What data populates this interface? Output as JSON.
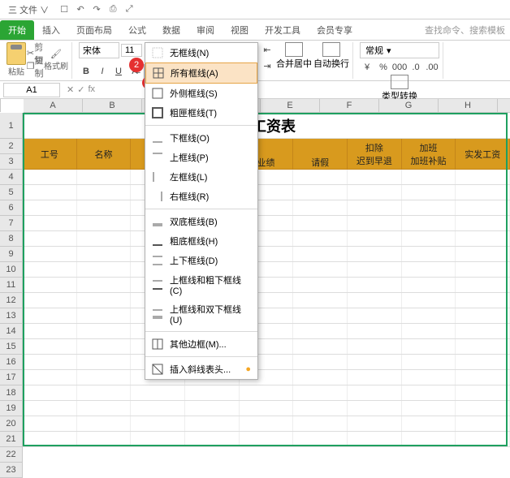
{
  "menubar": {
    "file": "三 文件 ∨",
    "tabs": [
      "开始",
      "插入",
      "页面布局",
      "公式",
      "数据",
      "审阅",
      "视图",
      "开发工具",
      "会员专享"
    ],
    "search_placeholder": "查找命令、搜索模板",
    "active_tab": 0
  },
  "ribbon": {
    "paste": {
      "label": "粘贴",
      "cut": "剪切",
      "copy": "复制",
      "format_painter": "格式刷"
    },
    "font": {
      "name": "宋体",
      "size": "11"
    },
    "buttons": {
      "bold": "B",
      "italic": "I",
      "underline": "U",
      "strike": "A"
    },
    "merge": "合并居中",
    "wrap": "自动换行",
    "number": {
      "format": "常规",
      "convert": "类型转换"
    }
  },
  "namebox": {
    "cell": "A1",
    "fx": "fx"
  },
  "cols": [
    "A",
    "B",
    "C",
    "D",
    "E",
    "F",
    "G",
    "H",
    "I"
  ],
  "row_count": 23,
  "title": "部工资表",
  "headers": {
    "c1": "工号",
    "c2": "名称",
    "c5": "业绩",
    "c6": "请假",
    "deduct_top": "扣除",
    "deduct_a": "迟到早退",
    "ot_top": "加班",
    "ot_a": "加班补贴",
    "actual": "实发工资"
  },
  "border_menu": {
    "items": [
      {
        "label": "无框线(N)",
        "ico": "none"
      },
      {
        "label": "所有框线(A)",
        "ico": "all",
        "hi": true
      },
      {
        "label": "外侧框线(S)",
        "ico": "out"
      },
      {
        "label": "粗匣框线(T)",
        "ico": "thick"
      },
      {
        "sep": true
      },
      {
        "label": "下框线(O)",
        "ico": "bot"
      },
      {
        "label": "上框线(P)",
        "ico": "top"
      },
      {
        "label": "左框线(L)",
        "ico": "left"
      },
      {
        "label": "右框线(R)",
        "ico": "right"
      },
      {
        "sep": true
      },
      {
        "label": "双底框线(B)",
        "ico": "dbot"
      },
      {
        "label": "粗底框线(H)",
        "ico": "tbot"
      },
      {
        "label": "上下框线(D)",
        "ico": "tb"
      },
      {
        "label": "上框线和粗下框线(C)",
        "ico": "ttb"
      },
      {
        "label": "上框线和双下框线(U)",
        "ico": "tdb"
      },
      {
        "sep": true
      },
      {
        "label": "其他边框(M)...",
        "ico": "more"
      },
      {
        "sep": true
      },
      {
        "label": "插入斜线表头...",
        "ico": "diag",
        "plus": true
      }
    ]
  },
  "callouts": {
    "c1": "1",
    "c2": "2"
  }
}
